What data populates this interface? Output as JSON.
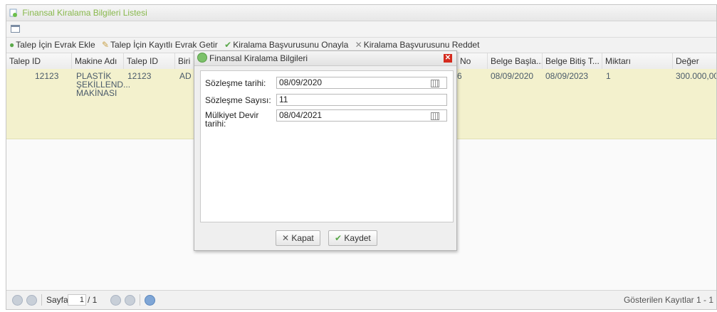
{
  "panel": {
    "title": "Finansal Kiralama Bilgileri Listesi"
  },
  "toolbar": {
    "add_document": "Talep İçin Evrak Ekle",
    "fetch_documents": "Talep İçin Kayıtlı Evrak Getir",
    "approve": "Kiralama Başvurusunu Onayla",
    "reject": "Kiralama Başvurusunu Reddet"
  },
  "columns": [
    "Talep ID",
    "Makine Adı",
    "Talep ID",
    "Biri",
    "No",
    "Belge Başla...",
    "Belge Bitiş T...",
    "Miktarı",
    "Değer"
  ],
  "row": {
    "talep_id": "12123",
    "makine_line1": "PLASTİK",
    "makine_line2": "ŞEKİLLEND...",
    "makine_line3": "MAKİNASI",
    "talep_id2": "12123",
    "birim": "AD",
    "no": "6",
    "belge_baslangic": "08/09/2020",
    "belge_bitis": "08/09/2023",
    "miktar": "1",
    "deger": "300.000,00"
  },
  "pager": {
    "label": "Sayfa",
    "current": "1",
    "total": "/ 1",
    "records": "Gösterilen Kayıtlar 1 - 1"
  },
  "dialog": {
    "title": "Finansal Kiralama Bilgileri",
    "fields": {
      "contract_date_label": "Sözleşme tarihi:",
      "contract_date_value": "08/09/2020",
      "contract_no_label": "Sözleşme Sayısı:",
      "contract_no_value": "11",
      "transfer_label_1": "Mülkiyet Devir",
      "transfer_label_2": "tarihi:",
      "transfer_value": "08/04/2021"
    },
    "close_label": "Kapat",
    "save_label": "Kaydet"
  }
}
